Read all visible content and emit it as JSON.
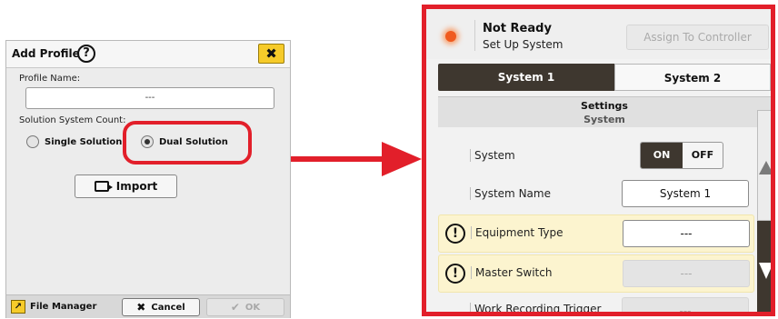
{
  "dialog": {
    "title": "Add Profile",
    "help_icon": "?",
    "close_icon": "✖",
    "profile_name_label": "Profile Name:",
    "profile_name_value": "---",
    "solution_count_label": "Solution System Count:",
    "options": [
      {
        "label": "Single Solution",
        "selected": false
      },
      {
        "label": "Dual Solution",
        "selected": true
      }
    ],
    "import_label": "Import",
    "footer": {
      "file_manager_label": "File Manager",
      "cancel_label": "Cancel",
      "ok_label": "OK"
    }
  },
  "panel": {
    "status_title": "Not Ready",
    "status_subtitle": "Set Up System",
    "assign_label": "Assign To Controller",
    "tabs": [
      {
        "label": "System 1",
        "active": true
      },
      {
        "label": "System 2",
        "active": false
      }
    ],
    "settings_title": "Settings",
    "settings_subtitle": "System",
    "rows": [
      {
        "label": "System",
        "control": "toggle",
        "on_label": "ON",
        "off_label": "OFF"
      },
      {
        "label": "System Name",
        "value": "System 1"
      },
      {
        "label": "Equipment Type",
        "value": "---",
        "warning": true
      },
      {
        "label": "Master Switch",
        "value": "---",
        "warning": true
      },
      {
        "label": "Work Recording Trigger",
        "value": "---"
      }
    ]
  },
  "colors": {
    "highlight_red": "#e21f2a",
    "accent_yellow": "#f6cb2a",
    "dark_brown": "#3e372f",
    "warning_bg": "#fcf4cf",
    "status_led": "#f05a1e"
  }
}
